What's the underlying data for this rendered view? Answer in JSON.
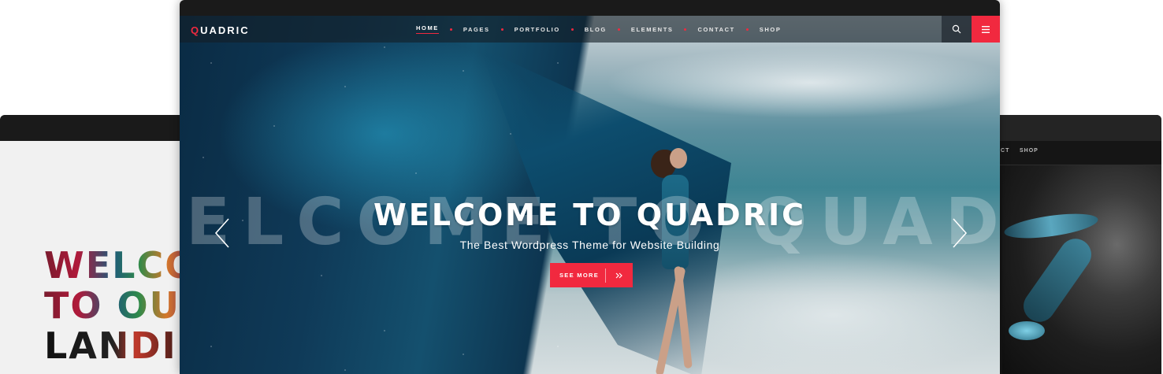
{
  "left_mockup": {
    "headline_lines": [
      "WELCO",
      "TO OU",
      "LANDI"
    ]
  },
  "right_mockup": {
    "nav_items": [
      "ACT",
      "SHOP"
    ]
  },
  "main": {
    "logo": {
      "first_letter": "Q",
      "rest": "UADRIC"
    },
    "nav": {
      "items": [
        "HOME",
        "PAGES",
        "PORTFOLIO",
        "BLOG",
        "ELEMENTS",
        "CONTACT",
        "SHOP"
      ],
      "active": "HOME"
    },
    "search_icon": "search-icon",
    "menu_icon": "hamburger-icon",
    "hero": {
      "background_text": "ELCOME TO QUADR",
      "title": "WELCOME TO QUADRIC",
      "subtitle": "The Best Wordpress Theme for Website Building",
      "cta_label": "SEE MORE",
      "cta_icon": "double-chevron-right-icon",
      "prev_icon": "chevron-left-icon",
      "next_icon": "chevron-right-icon"
    },
    "colors": {
      "accent": "#f1293f",
      "navbar": "#1e2a33"
    }
  }
}
